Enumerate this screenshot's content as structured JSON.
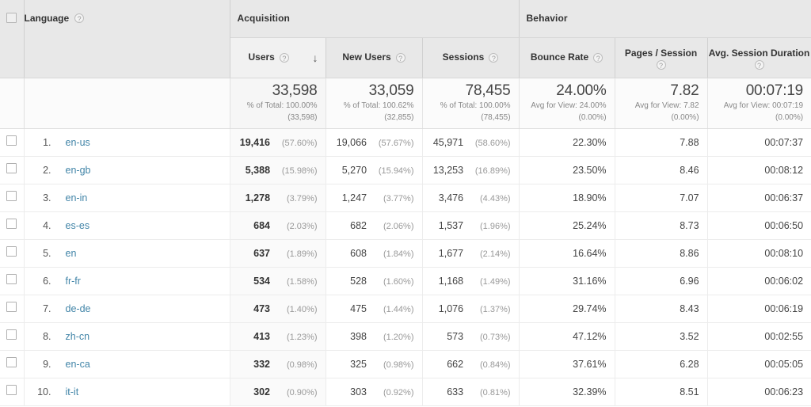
{
  "table": {
    "checkbox_icon": "checkbox-icon",
    "help_icon": "help-icon",
    "sort_arrow_icon": "sort-descending-arrow-icon",
    "dimension_header": "Language",
    "groups": [
      {
        "label": "Acquisition"
      },
      {
        "label": "Behavior"
      }
    ],
    "metrics": [
      {
        "key": "users",
        "label": "Users",
        "sorted": true,
        "sort_direction": "descending"
      },
      {
        "key": "new_users",
        "label": "New Users",
        "sorted": false
      },
      {
        "key": "sessions",
        "label": "Sessions",
        "sorted": false
      },
      {
        "key": "bounce",
        "label": "Bounce Rate",
        "sorted": false
      },
      {
        "key": "pages",
        "label": "Pages / Session",
        "sorted": false
      },
      {
        "key": "duration",
        "label": "Avg. Session Duration",
        "sorted": false
      }
    ],
    "summary": {
      "users": {
        "value": "33,598",
        "line2": "% of Total: 100.00%",
        "line3": "(33,598)"
      },
      "new_users": {
        "value": "33,059",
        "line2": "% of Total: 100.62%",
        "line3": "(32,855)"
      },
      "sessions": {
        "value": "78,455",
        "line2": "% of Total: 100.00%",
        "line3": "(78,455)"
      },
      "bounce": {
        "value": "24.00%",
        "line2": "Avg for View: 24.00%",
        "line3": "(0.00%)"
      },
      "pages": {
        "value": "7.82",
        "line2": "Avg for View: 7.82",
        "line3": "(0.00%)"
      },
      "duration": {
        "value": "00:07:19",
        "line2": "Avg for View: 00:07:19",
        "line3": "(0.00%)"
      }
    },
    "rows": [
      {
        "index": "1.",
        "language": "en-us",
        "users": "19,416",
        "users_pct": "(57.60%)",
        "new_users": "19,066",
        "new_users_pct": "(57.67%)",
        "sessions": "45,971",
        "sessions_pct": "(58.60%)",
        "bounce": "22.30%",
        "pages": "7.88",
        "duration": "00:07:37"
      },
      {
        "index": "2.",
        "language": "en-gb",
        "users": "5,388",
        "users_pct": "(15.98%)",
        "new_users": "5,270",
        "new_users_pct": "(15.94%)",
        "sessions": "13,253",
        "sessions_pct": "(16.89%)",
        "bounce": "23.50%",
        "pages": "8.46",
        "duration": "00:08:12"
      },
      {
        "index": "3.",
        "language": "en-in",
        "users": "1,278",
        "users_pct": "(3.79%)",
        "new_users": "1,247",
        "new_users_pct": "(3.77%)",
        "sessions": "3,476",
        "sessions_pct": "(4.43%)",
        "bounce": "18.90%",
        "pages": "7.07",
        "duration": "00:06:37"
      },
      {
        "index": "4.",
        "language": "es-es",
        "users": "684",
        "users_pct": "(2.03%)",
        "new_users": "682",
        "new_users_pct": "(2.06%)",
        "sessions": "1,537",
        "sessions_pct": "(1.96%)",
        "bounce": "25.24%",
        "pages": "8.73",
        "duration": "00:06:50"
      },
      {
        "index": "5.",
        "language": "en",
        "users": "637",
        "users_pct": "(1.89%)",
        "new_users": "608",
        "new_users_pct": "(1.84%)",
        "sessions": "1,677",
        "sessions_pct": "(2.14%)",
        "bounce": "16.64%",
        "pages": "8.86",
        "duration": "00:08:10"
      },
      {
        "index": "6.",
        "language": "fr-fr",
        "users": "534",
        "users_pct": "(1.58%)",
        "new_users": "528",
        "new_users_pct": "(1.60%)",
        "sessions": "1,168",
        "sessions_pct": "(1.49%)",
        "bounce": "31.16%",
        "pages": "6.96",
        "duration": "00:06:02"
      },
      {
        "index": "7.",
        "language": "de-de",
        "users": "473",
        "users_pct": "(1.40%)",
        "new_users": "475",
        "new_users_pct": "(1.44%)",
        "sessions": "1,076",
        "sessions_pct": "(1.37%)",
        "bounce": "29.74%",
        "pages": "8.43",
        "duration": "00:06:19"
      },
      {
        "index": "8.",
        "language": "zh-cn",
        "users": "413",
        "users_pct": "(1.23%)",
        "new_users": "398",
        "new_users_pct": "(1.20%)",
        "sessions": "573",
        "sessions_pct": "(0.73%)",
        "bounce": "47.12%",
        "pages": "3.52",
        "duration": "00:02:55"
      },
      {
        "index": "9.",
        "language": "en-ca",
        "users": "332",
        "users_pct": "(0.98%)",
        "new_users": "325",
        "new_users_pct": "(0.98%)",
        "sessions": "662",
        "sessions_pct": "(0.84%)",
        "bounce": "37.61%",
        "pages": "6.28",
        "duration": "00:05:05"
      },
      {
        "index": "10.",
        "language": "it-it",
        "users": "302",
        "users_pct": "(0.90%)",
        "new_users": "303",
        "new_users_pct": "(0.92%)",
        "sessions": "633",
        "sessions_pct": "(0.81%)",
        "bounce": "32.39%",
        "pages": "8.51",
        "duration": "00:06:23"
      }
    ]
  },
  "colors": {
    "link": "#4285a8",
    "header_bg": "#e8e8e8",
    "sorted_bg": "#fafafa",
    "text": "#444444",
    "muted": "#999999"
  }
}
